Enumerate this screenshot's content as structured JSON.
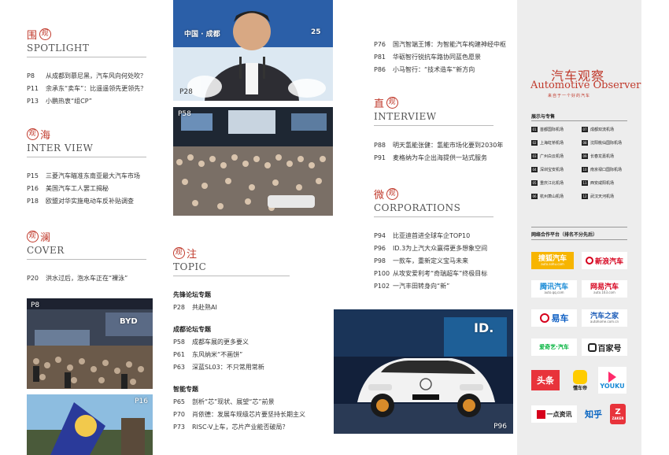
{
  "spotlight": {
    "cn": "围观",
    "stamp": "观",
    "en": "SPOTLIGHT",
    "items": [
      {
        "page": "P8",
        "title": "从成都到慕尼黑，汽车风向何处吹？"
      },
      {
        "page": "P11",
        "title": "余承东“卖车”：比遥遥领先更领先？"
      },
      {
        "page": "P13",
        "title": "小鹏热衷“组CP”"
      }
    ]
  },
  "interview_overseas": {
    "cn": "观海",
    "stamp": "观",
    "en": "INTER VIEW",
    "items": [
      {
        "page": "P15",
        "title": "三菱汽车瞄准东南亚最大汽车市场"
      },
      {
        "page": "P16",
        "title": "美国汽车工人罢工揭秘"
      },
      {
        "page": "P18",
        "title": "欧盟对华实施电动车反补贴调查"
      }
    ]
  },
  "cover": {
    "cn": "观澜",
    "stamp": "观",
    "en": "COVER",
    "items": [
      {
        "page": "P20",
        "title": "洪水过后，泡水车正在“裸泳”"
      }
    ]
  },
  "topic": {
    "cn": "观注",
    "stamp": "观",
    "en": "TOPIC",
    "groups": [
      {
        "name": "先锋论坛专题",
        "items": [
          {
            "page": "P28",
            "title": "共赴熟AI"
          }
        ]
      },
      {
        "name": "成都论坛专题",
        "items": [
          {
            "page": "P58",
            "title": "成都车展的更多要义"
          },
          {
            "page": "P61",
            "title": "东风纳米“不画饼”"
          },
          {
            "page": "P63",
            "title": "深蓝SL03：不只常用常新"
          }
        ]
      },
      {
        "name": "智能专题",
        "items": [
          {
            "page": "P65",
            "title": "剖析“芯”现状、展望“芯”前景"
          },
          {
            "page": "P70",
            "title": "肖依德：发展车规级芯片要坚持长期主义"
          },
          {
            "page": "P73",
            "title": "RISC-V上车，芯片产业能否破局？"
          }
        ]
      }
    ]
  },
  "middle_top": {
    "items": [
      {
        "page": "P76",
        "title": "国汽智端王博：为智能汽车构建神经中枢"
      },
      {
        "page": "P81",
        "title": "华砺智行锐抗车路协同蓝色愿景"
      },
      {
        "page": "P86",
        "title": "小马智行：“技术造车”新方向"
      }
    ]
  },
  "interview": {
    "cn": "直观",
    "stamp": "观",
    "en": "INTERVIEW",
    "items": [
      {
        "page": "P88",
        "title": "明天氢能张健：氢能市场化要到2030年"
      },
      {
        "page": "P91",
        "title": "麦格纳为车企出海提供一站式服务"
      }
    ]
  },
  "corporations": {
    "cn": "微观",
    "stamp": "观",
    "en": "CORPORATIONS",
    "items": [
      {
        "page": "P94",
        "title": "比亚迪首进全球车企TOP10"
      },
      {
        "page": "P96",
        "title": "ID.3为上汽大众赢得更多想象空间"
      },
      {
        "page": "P98",
        "title": "一款车，重新定义宝马未来"
      },
      {
        "page": "P100",
        "title": "从攻安爱利考“奇瑞超车”终极目标"
      },
      {
        "page": "P102",
        "title": "一汽丰田转身向“新”"
      }
    ]
  },
  "photos": {
    "p28": "P28",
    "p58": "P58",
    "p8": "P8",
    "p16": "P16",
    "p96": "P96",
    "p28_banner": "中国 · 成都",
    "p28_banner_num": "25",
    "p8_brand": "BYD",
    "p96_badge": "ID."
  },
  "sidebar": {
    "brand_cn": "汽车观察",
    "brand_en": "Automotive Observer",
    "brand_sub": "来自于一个好的汽车",
    "airports_title": "展示与专售",
    "airports": [
      {
        "num": "01",
        "name": "首都国际机场"
      },
      {
        "num": "07",
        "name": "成都双流机场"
      },
      {
        "num": "02",
        "name": "上海虹桥机场"
      },
      {
        "num": "08",
        "name": "沈阳桃仙国际机场"
      },
      {
        "num": "03",
        "name": "广州白云机场"
      },
      {
        "num": "09",
        "name": "长春龙嘉机场"
      },
      {
        "num": "04",
        "name": "深圳宝安机场"
      },
      {
        "num": "10",
        "name": "南京禄口国际机场"
      },
      {
        "num": "05",
        "name": "重庆江北机场"
      },
      {
        "num": "11",
        "name": "西安咸阳机场"
      },
      {
        "num": "06",
        "name": "杭州萧山机场"
      },
      {
        "num": "12",
        "name": "武汉天河机场"
      }
    ],
    "partners_title": "网络合作平台（排名不分先后）",
    "partners": [
      {
        "name": "搜狐汽车",
        "sub": "auto.sohu.com"
      },
      {
        "name": "新浪汽车"
      },
      {
        "name": "腾讯汽车",
        "sub": "auto.qq.com"
      },
      {
        "name": "网易汽车",
        "sub": "auto.163.com"
      },
      {
        "name": "易车"
      },
      {
        "name": "汽车之家",
        "sub": "autohome.com.cn"
      },
      {
        "name": "爱奇艺·汽车"
      },
      {
        "name": "百家号"
      },
      {
        "name": "头条"
      },
      {
        "name": "懂车帝"
      },
      {
        "name": "YOUKU"
      },
      {
        "name": "一点资讯"
      },
      {
        "name": "知乎"
      },
      {
        "name": "ZAKER"
      }
    ],
    "colors": {
      "accent": "#c0392b",
      "sidebar_bg": "#ededed"
    }
  }
}
